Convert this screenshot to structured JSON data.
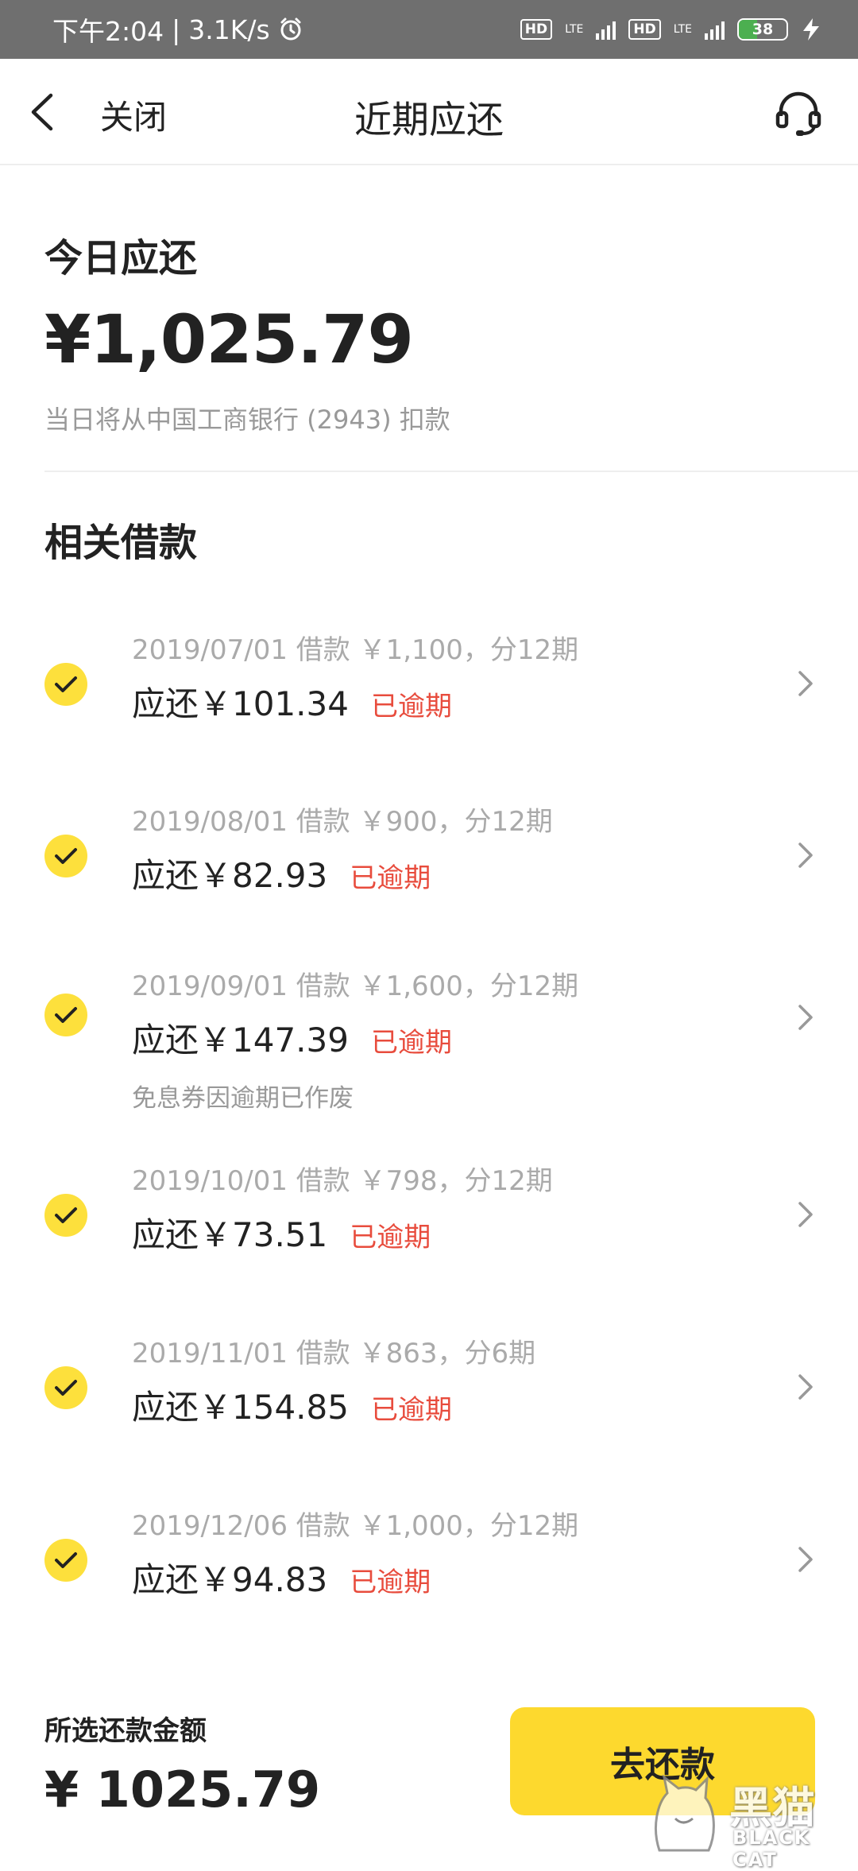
{
  "status_bar": {
    "time": "下午2:04",
    "speed": "3.1K/s",
    "hd1": "HD",
    "lte1": "LTE",
    "hd2": "HD",
    "lte2": "LTE",
    "battery": "38",
    "battery_level": 0.38
  },
  "nav": {
    "close_label": "关闭",
    "title": "近期应还"
  },
  "today": {
    "title": "今日应还",
    "amount": "¥1,025.79",
    "deduct_note": "当日将从中国工商银行 (2943) 扣款"
  },
  "related": {
    "title": "相关借款",
    "items": [
      {
        "info": "2019/07/01 借款 ￥1,100，分12期",
        "due": "应还￥101.34",
        "status": "已逾期",
        "note": ""
      },
      {
        "info": "2019/08/01 借款 ￥900，分12期",
        "due": "应还￥82.93",
        "status": "已逾期",
        "note": ""
      },
      {
        "info": "2019/09/01 借款 ￥1,600，分12期",
        "due": "应还￥147.39",
        "status": "已逾期",
        "note": "免息券因逾期已作废"
      },
      {
        "info": "2019/10/01 借款 ￥798，分12期",
        "due": "应还￥73.51",
        "status": "已逾期",
        "note": ""
      },
      {
        "info": "2019/11/01 借款 ￥863，分6期",
        "due": "应还￥154.85",
        "status": "已逾期",
        "note": ""
      },
      {
        "info": "2019/12/06 借款 ￥1,000，分12期",
        "due": "应还￥94.83",
        "status": "已逾期",
        "note": ""
      }
    ]
  },
  "footer": {
    "selected_label": "所选还款金额",
    "selected_amount": "¥ 1025.79",
    "pay_button": "去还款"
  },
  "watermark": {
    "text_cn": "黑猫",
    "text_en": "BLACK CAT"
  },
  "colors": {
    "accent_yellow": "#fdd92e",
    "overdue_red": "#e84c3d",
    "status_bar_bg": "#6f6f6f"
  }
}
